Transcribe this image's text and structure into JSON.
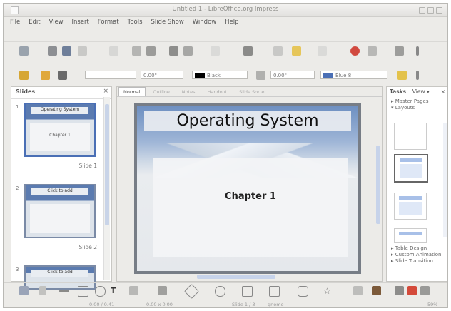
{
  "window": {
    "title": "Untitled 1 - LibreOffice.org Impress"
  },
  "menu": [
    "File",
    "Edit",
    "View",
    "Insert",
    "Format",
    "Tools",
    "Slide Show",
    "Window",
    "Help"
  ],
  "format_bar": {
    "line_width": "0.00\"",
    "color_name": "Black",
    "area_width": "0.00\"",
    "area_color": "Blue 8"
  },
  "slides_pane": {
    "title": "Slides",
    "slides": [
      {
        "number": "1",
        "caption": "Slide 1",
        "title": "Operating System",
        "body": "Chapter 1"
      },
      {
        "number": "2",
        "caption": "Slide 2",
        "title": "Click to add"
      },
      {
        "number": "3",
        "title": "Click to add"
      }
    ]
  },
  "view_tabs": [
    "Normal",
    "Outline",
    "Notes",
    "Handout",
    "Slide Sorter"
  ],
  "slide": {
    "title": "Operating System",
    "body": "Chapter 1"
  },
  "tasks_pane": {
    "title": "Tasks",
    "view_label": "View ▾",
    "sections_top": [
      "Master Pages",
      "Layouts"
    ],
    "sections_bottom": [
      "Table Design",
      "Custom Animation",
      "Slide Transition"
    ]
  },
  "status": {
    "position": "0.00 / 0.41",
    "size": "0.00 x 0.00",
    "slide_indicator": "Slide 1 / 3",
    "master": "gnome",
    "zoom": "59%"
  },
  "colors": {
    "accent": "#5b7bb0",
    "selection": "#c7d3ea"
  }
}
